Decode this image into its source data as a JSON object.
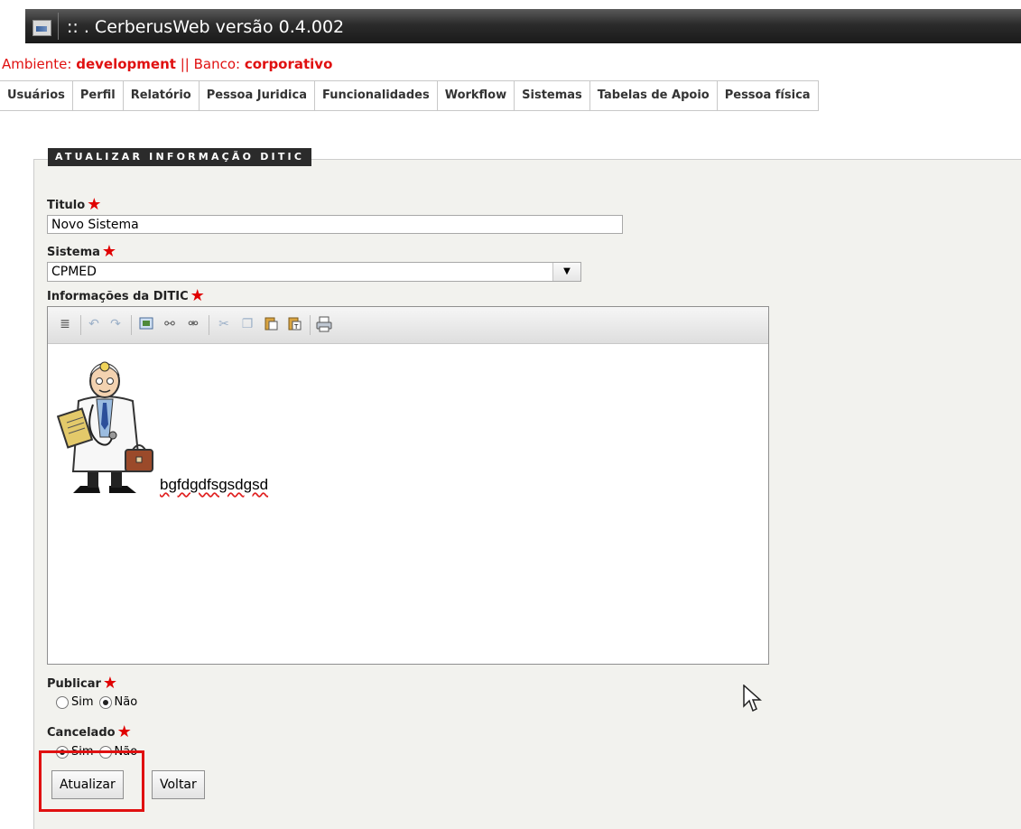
{
  "window": {
    "title": ":: .  CerberusWeb versão 0.4.002",
    "icon": "app-window-icon"
  },
  "env": {
    "ambiente_label": "Ambiente: ",
    "ambiente_value": "development",
    "separator": " || ",
    "banco_label": "Banco: ",
    "banco_value": "corporativo"
  },
  "menu": [
    "Usuários",
    "Perfil",
    "Relatório",
    "Pessoa Juridica",
    "Funcionalidades",
    "Workflow",
    "Sistemas",
    "Tabelas de Apoio",
    "Pessoa física"
  ],
  "form": {
    "legend": "ATUALIZAR INFORMAÇÃO DITIC",
    "titulo_label": "Titulo",
    "titulo_value": "Novo Sistema",
    "sistema_label": "Sistema",
    "sistema_value": "CPMED",
    "info_label": "Informações da DITIC",
    "editor_text": "bgfdgdfsgsdgsd",
    "editor_toolbar": [
      "justify-icon",
      "undo-icon",
      "redo-icon",
      "image-icon",
      "link-icon",
      "unlink-icon",
      "cut-icon",
      "copy-icon",
      "paste-icon",
      "paste-text-icon",
      "print-icon"
    ],
    "publicar_label": "Publicar",
    "cancelado_label": "Cancelado",
    "sim": "Sim",
    "nao": "Não",
    "publicar_selected": "Não",
    "cancelado_selected": "Sim",
    "atualizar_button": "Atualizar",
    "voltar_button": "Voltar"
  },
  "colors": {
    "env_red": "#e01010",
    "required_star": "#e00000",
    "highlight_box": "#e01010"
  }
}
